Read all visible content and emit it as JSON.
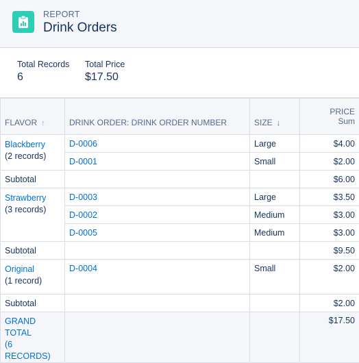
{
  "header": {
    "label": "REPORT",
    "title": "Drink Orders",
    "icon": "report-icon",
    "accent": "#2ecdb5"
  },
  "summary": {
    "total_records_label": "Total Records",
    "total_records_value": "6",
    "total_price_label": "Total Price",
    "total_price_value": "$17.50"
  },
  "table": {
    "columns": {
      "flavor": "FLAVOR",
      "order_number": "DRINK ORDER: DRINK ORDER NUMBER",
      "size": "SIZE",
      "price": "PRICE",
      "price_sub": "Sum"
    },
    "groups": [
      {
        "flavor": "Blackberry",
        "count": "(2 records)",
        "rows": [
          {
            "order": "D-0006",
            "size": "Large",
            "price": "$4.00"
          },
          {
            "order": "D-0001",
            "size": "Small",
            "price": "$2.00"
          }
        ],
        "subtotal_label": "Subtotal",
        "subtotal": "$6.00"
      },
      {
        "flavor": "Strawberry",
        "count": "(3 records)",
        "rows": [
          {
            "order": "D-0003",
            "size": "Large",
            "price": "$3.50"
          },
          {
            "order": "D-0002",
            "size": "Medium",
            "price": "$3.00"
          },
          {
            "order": "D-0005",
            "size": "Medium",
            "price": "$3.00"
          }
        ],
        "subtotal_label": "Subtotal",
        "subtotal": "$9.50"
      },
      {
        "flavor": "Original",
        "count": "(1 record)",
        "rows": [
          {
            "order": "D-0004",
            "size": "Small",
            "price": "$2.00"
          }
        ],
        "subtotal_label": "Subtotal",
        "subtotal": "$2.00"
      }
    ],
    "grand_total_label": "GRAND TOTAL",
    "grand_total_count": "(6 RECORDS)",
    "grand_total": "$17.50"
  }
}
